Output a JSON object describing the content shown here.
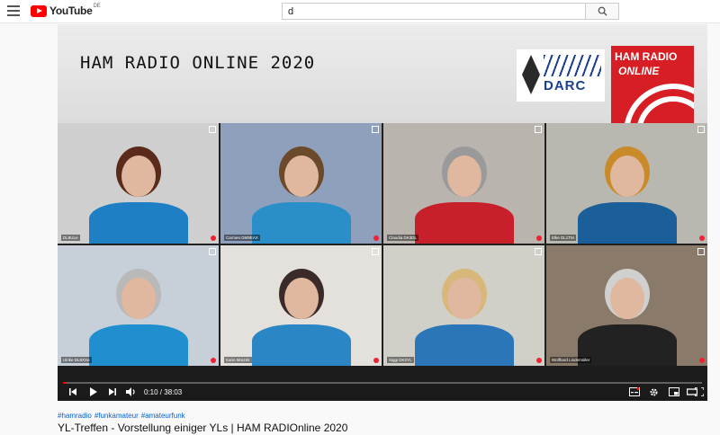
{
  "topbar": {
    "logo_text": "YouTube",
    "country": "DE",
    "search_value": "d"
  },
  "video": {
    "header_title": "HAM RADIO ONLINE 2020",
    "darc_text": "DARC",
    "hamradio_text": "HAM RADIO",
    "hamradio_sub": "ONLINE",
    "participants": [
      {
        "label": "DL8ULe",
        "bg": "#cfcfcf",
        "shirt": "#1f7fc4",
        "hair": "#5a2a1a"
      },
      {
        "label": "Carmen DM9EAX",
        "bg": "#8fa0bd",
        "shirt": "#2a8fc9",
        "hair": "#6a4a2a"
      },
      {
        "label": "Claudia DK3DL",
        "bg": "#b9b4ae",
        "shirt": "#c8202a",
        "hair": "#9a9a9a"
      },
      {
        "label": "Elke DL1TM",
        "bg": "#b8b8b0",
        "shirt": "#1a5e9a",
        "hair": "#c98a2a"
      },
      {
        "label": "Ulrike DL9XXe",
        "bg": "#c7cfd8",
        "shirt": "#1f8fd0",
        "hair": "#b9b9b9"
      },
      {
        "label": "Karin Mrazek",
        "bg": "#e4e0dc",
        "shirt": "#2a86c4",
        "hair": "#3a2a2a"
      },
      {
        "label": "Siggi DK2YL",
        "bg": "#d0d0c8",
        "shirt": "#2a76b8",
        "hair": "#d8b87a"
      },
      {
        "label": "Wolfhard Lindemüller",
        "bg": "#8a7a6a",
        "shirt": "#222222",
        "hair": "#d0d0d0"
      }
    ],
    "time": "0:10 / 38:03",
    "progress": 0.004
  },
  "below": {
    "hashtags": [
      "#hamradio",
      "#funkamateur",
      "#amateurfunk"
    ],
    "title": "YL-Treffen - Vorstellung einiger YLs | HAM RADIOnline 2020"
  }
}
